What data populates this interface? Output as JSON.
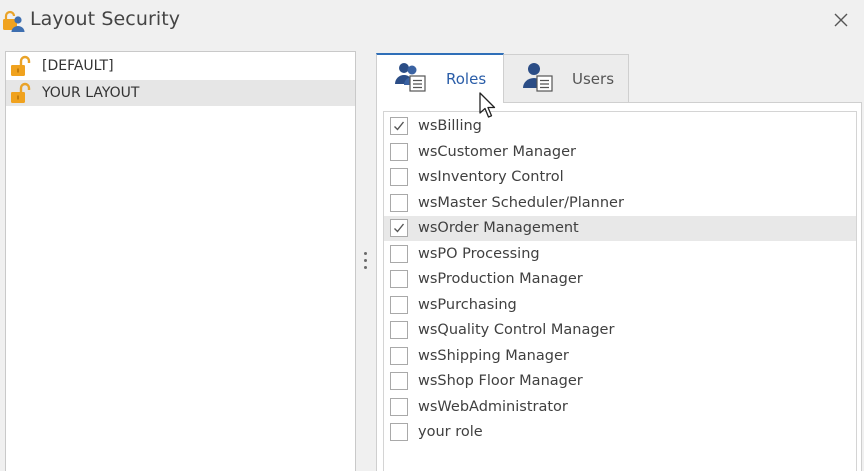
{
  "window": {
    "title": "Layout Security",
    "icon": "user-lock-icon",
    "close_icon": "close-icon"
  },
  "layouts": [
    {
      "label": "[DEFAULT]",
      "icon": "unlocked-padlock-icon",
      "selected": false
    },
    {
      "label": "YOUR LAYOUT",
      "icon": "unlocked-padlock-icon",
      "selected": true
    }
  ],
  "tabs": [
    {
      "label": "Roles",
      "icon": "users-list-icon",
      "active": true
    },
    {
      "label": "Users",
      "icon": "user-list-icon",
      "active": false
    }
  ],
  "roles": [
    {
      "label": "wsBilling",
      "checked": true
    },
    {
      "label": "wsCustomer Manager",
      "checked": false
    },
    {
      "label": "wsInventory Control",
      "checked": false
    },
    {
      "label": "wsMaster Scheduler/Planner",
      "checked": false
    },
    {
      "label": "wsOrder Management",
      "checked": true,
      "highlighted": true
    },
    {
      "label": "wsPO Processing",
      "checked": false
    },
    {
      "label": "wsProduction Manager",
      "checked": false
    },
    {
      "label": "wsPurchasing",
      "checked": false
    },
    {
      "label": "wsQuality Control Manager",
      "checked": false
    },
    {
      "label": "wsShipping Manager",
      "checked": false
    },
    {
      "label": "wsShop Floor Manager",
      "checked": false
    },
    {
      "label": "wsWebAdministrator",
      "checked": false
    },
    {
      "label": "your role",
      "checked": false
    }
  ],
  "colors": {
    "lock_orange": "#f0a21e",
    "tab_accent": "#2f6fb8",
    "icon_blue": "#2b4d86"
  }
}
